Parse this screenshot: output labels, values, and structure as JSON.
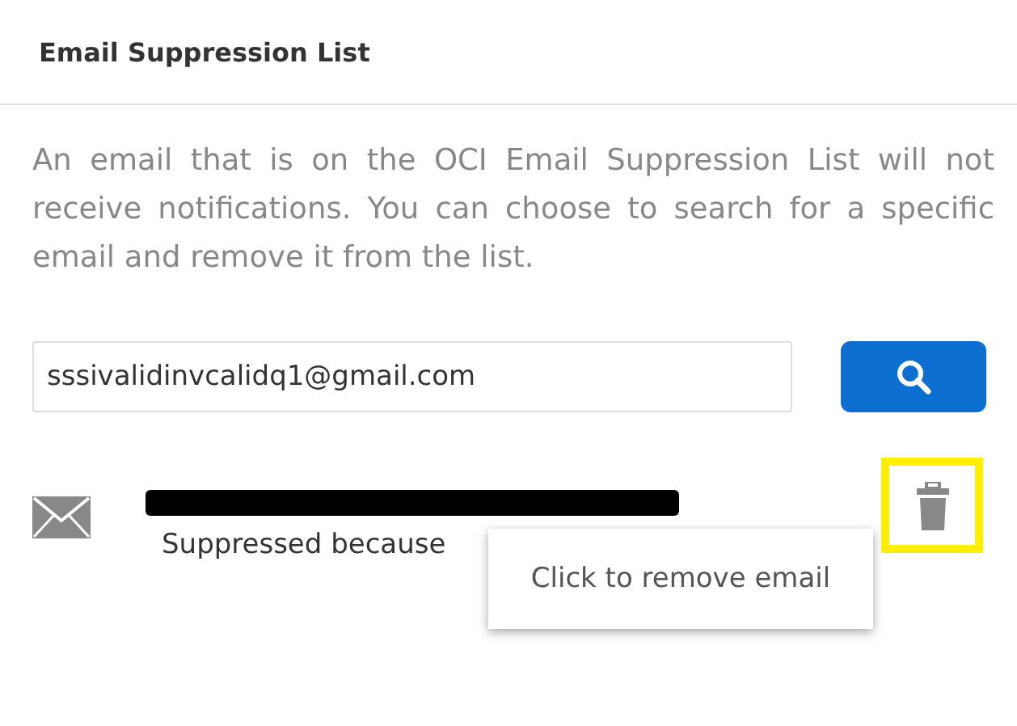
{
  "panel": {
    "title": "Email Suppression List"
  },
  "description": "An email that is on the OCI Email Suppression List will not receive notifications. You can choose to search for a specific email and remove it from the list.",
  "search": {
    "value": "sssivalidinvcalidq1@gmail.com"
  },
  "results": [
    {
      "reason": "Suppressed because",
      "highlighted": true,
      "tooltip": "Click to remove email"
    }
  ]
}
